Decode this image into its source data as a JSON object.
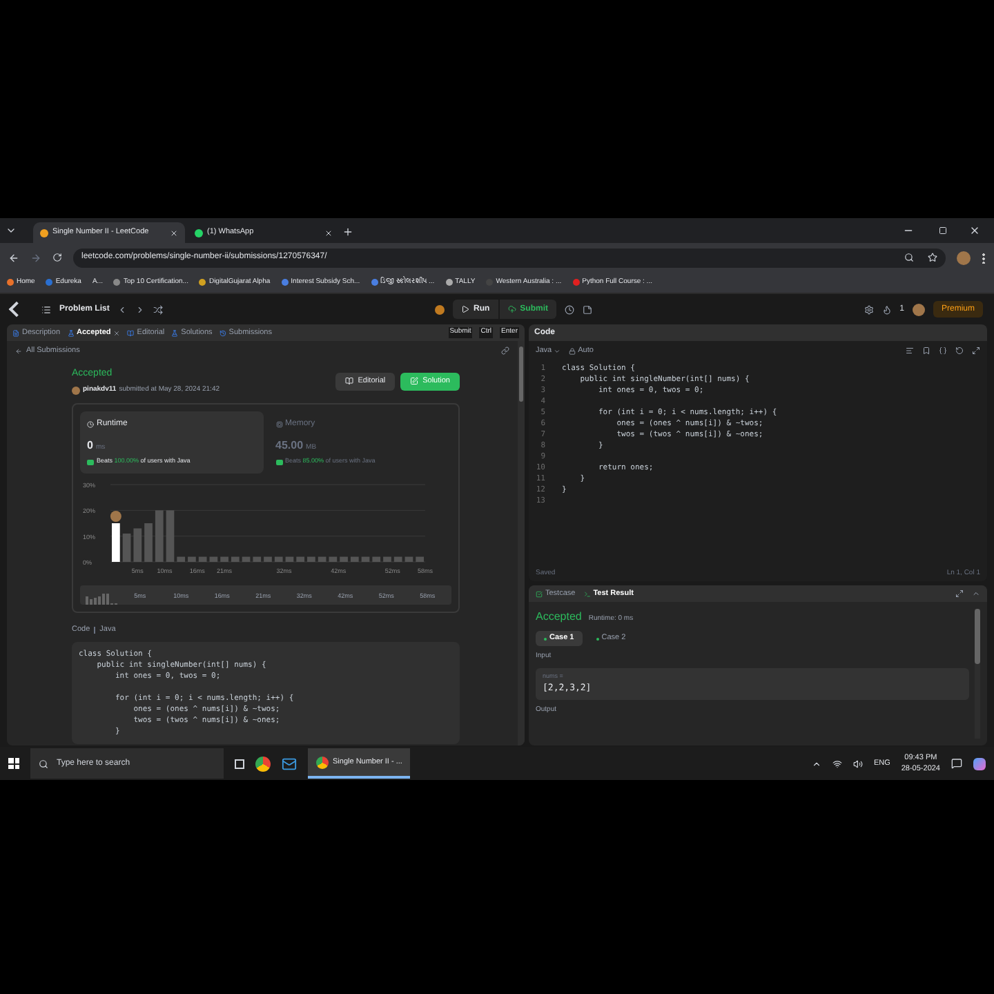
{
  "browser": {
    "tabs": [
      {
        "title": "Single Number II - LeetCode",
        "selected": true
      },
      {
        "title": "(1) WhatsApp",
        "selected": false
      }
    ],
    "url": "leetcode.com/problems/single-number-ii/submissions/1270576347/",
    "bookmarks": [
      "Home",
      "Edureka",
      "A...",
      "Top 10 Certification...",
      "DigitalGujarat Alpha",
      "Interest Subsidy Sch...",
      "ડિજી સ્કોલરશીપ ...",
      "TALLY",
      "Western Australia : ...",
      "Python Full Course : ..."
    ]
  },
  "nav": {
    "problem_list": "Problem List",
    "run": "Run",
    "submit": "Submit",
    "streak": "1",
    "premium": "Premium"
  },
  "left_tabs": [
    {
      "label": "Description",
      "selected": false,
      "closable": false
    },
    {
      "label": "Accepted",
      "selected": true,
      "closable": true
    },
    {
      "label": "Editorial",
      "selected": false,
      "closable": false
    },
    {
      "label": "Solutions",
      "selected": false,
      "closable": false
    },
    {
      "label": "Submissions",
      "selected": false,
      "closable": false
    }
  ],
  "shortcut": [
    "Submit",
    "Ctrl",
    "Enter"
  ],
  "submission": {
    "back": "All Submissions",
    "status": "Accepted",
    "user": "pinakdv11",
    "submitted": "submitted at May 28, 2024 21:42",
    "editorial_button": "Editorial",
    "solution_button": "Solution",
    "stats": [
      {
        "label": "Runtime",
        "value": "0",
        "unit": "ms",
        "beats": "Beats **100.00%** of users with Java",
        "selected": true
      },
      {
        "label": "Memory",
        "value": "45.00",
        "unit": "MB",
        "beats": "Beats **85.00%** of users with Java",
        "selected": false
      }
    ],
    "chart_data": {
      "type": "bar",
      "x": [
        1,
        3,
        5,
        7,
        9,
        11,
        13,
        15,
        17,
        19,
        21,
        23,
        25,
        27,
        29,
        31,
        33,
        35,
        37,
        39,
        41,
        43,
        45,
        47,
        49,
        51,
        53,
        55,
        57
      ],
      "xlim": [
        0,
        58
      ],
      "values": [
        15,
        11,
        13,
        15,
        20,
        20,
        2,
        2,
        2,
        2,
        2,
        2,
        2,
        2,
        2,
        2,
        2,
        2,
        2,
        2,
        2,
        2,
        2,
        2,
        2,
        2,
        2,
        2,
        2
      ],
      "ylim": [
        0,
        30
      ],
      "yticks": [
        {
          "value": 0,
          "label": "0%"
        },
        {
          "value": 10,
          "label": "10%"
        },
        {
          "value": 20,
          "label": "20%"
        },
        {
          "value": 30,
          "label": "30%"
        }
      ],
      "xticks": [
        {
          "value": 5,
          "label": "5ms"
        },
        {
          "value": 10,
          "label": "10ms"
        },
        {
          "value": 16,
          "label": "16ms"
        },
        {
          "value": 21,
          "label": "21ms"
        },
        {
          "value": 32,
          "label": "32ms"
        },
        {
          "value": 42,
          "label": "42ms"
        },
        {
          "value": 52,
          "label": "52ms"
        },
        {
          "value": 58,
          "label": "58ms"
        }
      ]
    },
    "range_labels": [
      "5ms",
      "10ms",
      "16ms",
      "21ms",
      "32ms",
      "42ms",
      "52ms",
      "58ms"
    ],
    "code_label": "Code",
    "code_lang": "Java",
    "code": [
      [
        {
          "text": "class Solution {"
        },
        {
          "text": "    public int singleNumber(int[] nums) {"
        },
        {
          "text": "        int ones = 0, twos = 0;"
        }
      ],
      [
        {
          "text": "        for (int i = 0; i < nums.length; i++) {"
        },
        {
          "text": "            ones = (ones ^ nums[i]) & ~twos;"
        },
        {
          "text": "            twos = (twos ^ nums[i]) & ~ones;"
        },
        {
          "text": "        }"
        }
      ]
    ]
  },
  "editor": {
    "title": "Code",
    "language": "Java",
    "mode": "Auto",
    "lines": [
      {
        "n": "1",
        "text": "class Solution {"
      },
      {
        "n": "2",
        "text": "    public int singleNumber(int[] nums) {"
      },
      {
        "n": "3",
        "text": "        int ones = 0, twos = 0;"
      },
      {
        "n": "4"
      },
      {
        "n": "5",
        "text": "        for (int i = 0; i < nums.length; i++) {"
      },
      {
        "n": "6",
        "text": "            ones = (ones ^ nums[i]) & ~twos;"
      },
      {
        "n": "7",
        "text": "            twos = (twos ^ nums[i]) & ~ones;"
      },
      {
        "n": "8",
        "text": "        }"
      },
      {
        "n": "9"
      },
      {
        "n": "10",
        "text": "        return ones;"
      },
      {
        "n": "11",
        "text": "    }"
      },
      {
        "n": "12",
        "text": "}"
      },
      {
        "n": "13"
      }
    ],
    "saved": "Saved",
    "position": "Ln 1, Col 1"
  },
  "test": {
    "tabs": [
      {
        "label": "Testcase",
        "selected": false
      },
      {
        "label": "Test Result",
        "selected": true
      }
    ],
    "status": "Accepted",
    "runtime": "Runtime: 0 ms",
    "cases": [
      {
        "label": "Case 1",
        "selected": true
      },
      {
        "label": "Case 2",
        "selected": false
      }
    ],
    "input_label": "Input",
    "var": "nums =",
    "value": "[2,2,3,2]",
    "output_label": "Output"
  },
  "taskbar": {
    "search": "Type here to search",
    "window": "Single Number II - ...",
    "lang": "ENG",
    "time": "09:43 PM",
    "date": "28-05-2024"
  }
}
